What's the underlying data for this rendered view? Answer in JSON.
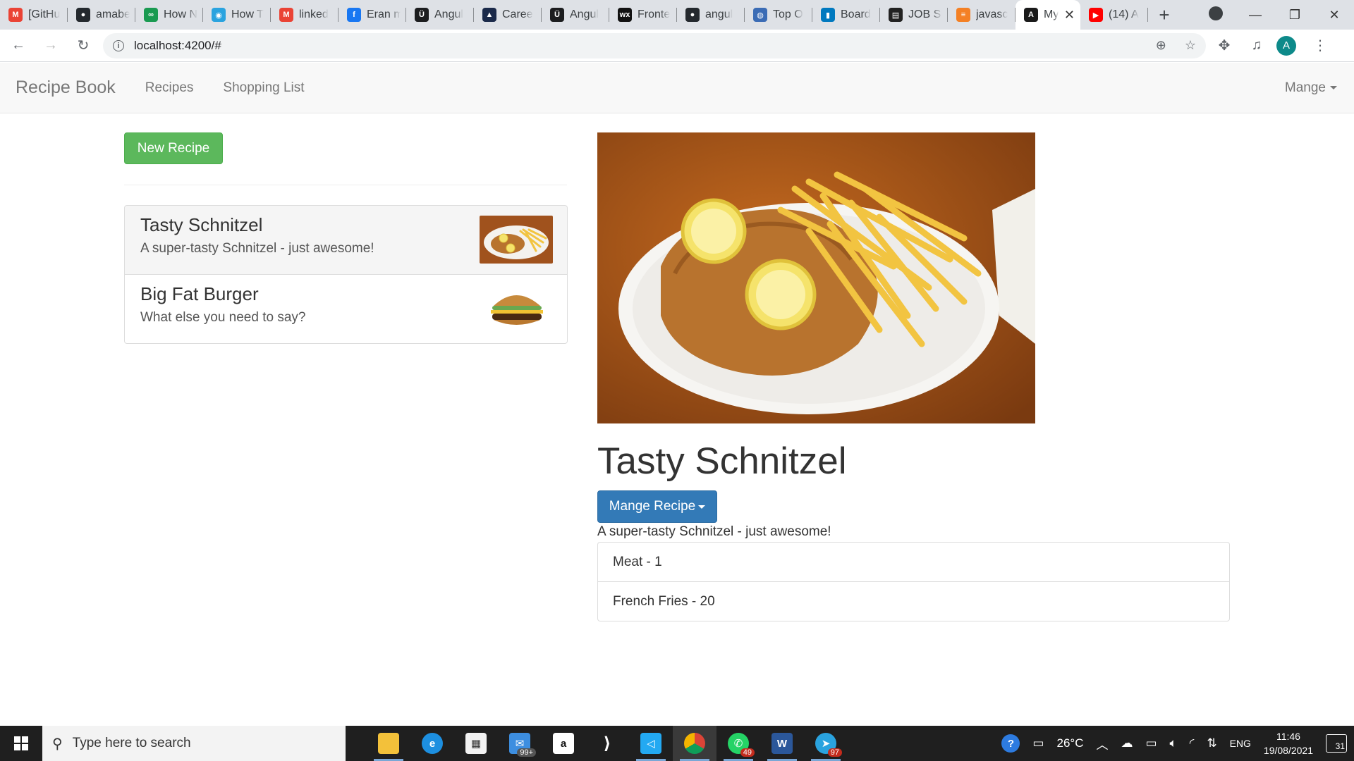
{
  "browser": {
    "tabs": [
      {
        "title": "[GitHu",
        "icon": "gmail-icon",
        "color": "#ea4335",
        "glyph": "M"
      },
      {
        "title": "amabe",
        "icon": "github-icon",
        "color": "#24292e",
        "glyph": "●"
      },
      {
        "title": "How N",
        "icon": "codota-icon",
        "color": "#1a9a51",
        "glyph": "∞"
      },
      {
        "title": "How T",
        "icon": "web-icon",
        "color": "#2aa3df",
        "glyph": "◉"
      },
      {
        "title": "linked",
        "icon": "gmail-icon",
        "color": "#ea4335",
        "glyph": "M"
      },
      {
        "title": "Eran m",
        "icon": "facebook-icon",
        "color": "#1877f2",
        "glyph": "f"
      },
      {
        "title": "Angul",
        "icon": "udemy-icon",
        "color": "#1c1d1f",
        "glyph": "Ü"
      },
      {
        "title": "Caree",
        "icon": "career-icon",
        "color": "#1b2a4a",
        "glyph": "▲"
      },
      {
        "title": "Angul",
        "icon": "udemy-icon",
        "color": "#1c1d1f",
        "glyph": "Ü"
      },
      {
        "title": "Fronte",
        "icon": "wix-icon",
        "color": "#111111",
        "glyph": "wx"
      },
      {
        "title": "angul",
        "icon": "github-icon",
        "color": "#24292e",
        "glyph": "●"
      },
      {
        "title": "Top O",
        "icon": "globe-icon",
        "color": "#3b6cb5",
        "glyph": "◍"
      },
      {
        "title": "Board",
        "icon": "trello-icon",
        "color": "#0079bf",
        "glyph": "▮"
      },
      {
        "title": "JOB SI",
        "icon": "job-icon",
        "color": "#222222",
        "glyph": "▤"
      },
      {
        "title": "javasc",
        "icon": "stackoverflow-icon",
        "color": "#f48024",
        "glyph": "≡"
      }
    ],
    "active_tab": {
      "title": "My",
      "icon": "angular-icon",
      "color": "#1a1a1a",
      "glyph": "A"
    },
    "after_tab": {
      "title": "(14) A",
      "icon": "youtube-icon",
      "color": "#ff0000",
      "glyph": "▶"
    },
    "url": "localhost:4200/#",
    "profile_initial": "A"
  },
  "navbar": {
    "brand": "Recipe Book",
    "links": [
      "Recipes",
      "Shopping List"
    ],
    "manage": "Mange"
  },
  "sidebar": {
    "new_recipe": "New Recipe",
    "recipes": [
      {
        "name": "Tasty Schnitzel",
        "description": "A super-tasty Schnitzel - just awesome!"
      },
      {
        "name": "Big Fat Burger",
        "description": "What else you need to say?"
      }
    ]
  },
  "detail": {
    "name": "Tasty Schnitzel",
    "manage_button": "Mange Recipe",
    "description": "A super-tasty Schnitzel - just awesome!",
    "ingredients": [
      "Meat - 1",
      "French Fries - 20"
    ]
  },
  "taskbar": {
    "search_placeholder": "Type here to search",
    "mail_badge": "99+",
    "whatsapp_badge": "49",
    "telegram_badge": "97",
    "temperature": "26°C",
    "language": "ENG",
    "time": "11:46",
    "date": "19/08/2021",
    "notifications": "31"
  }
}
